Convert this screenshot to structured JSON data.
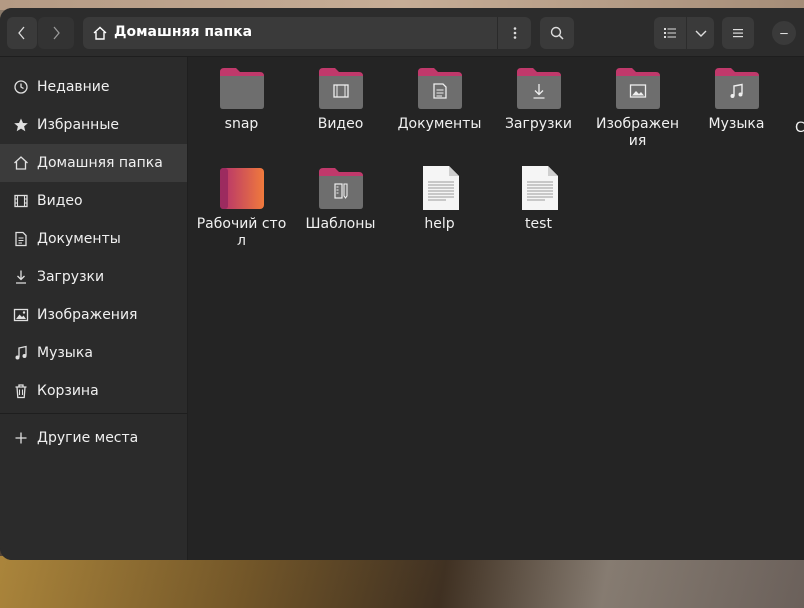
{
  "window": {
    "title": "Домашняя папка"
  },
  "pathbar": {
    "location": "Домашняя папка"
  },
  "sidebar": {
    "items": [
      {
        "label": "Недавние",
        "icon": "clock-icon"
      },
      {
        "label": "Избранные",
        "icon": "star-icon"
      },
      {
        "label": "Домашняя папка",
        "icon": "home-icon",
        "active": true
      },
      {
        "label": "Видео",
        "icon": "video-icon"
      },
      {
        "label": "Документы",
        "icon": "document-icon"
      },
      {
        "label": "Загрузки",
        "icon": "download-icon"
      },
      {
        "label": "Изображения",
        "icon": "image-icon"
      },
      {
        "label": "Музыка",
        "icon": "music-icon"
      },
      {
        "label": "Корзина",
        "icon": "trash-icon"
      }
    ],
    "other_places": {
      "label": "Другие места",
      "icon": "plus-icon"
    }
  },
  "files": [
    {
      "name": "snap",
      "type": "folder",
      "emblem": ""
    },
    {
      "name": "Видео",
      "type": "folder",
      "emblem": "video"
    },
    {
      "name": "Документы",
      "type": "folder",
      "emblem": "document"
    },
    {
      "name": "Загрузки",
      "type": "folder",
      "emblem": "download"
    },
    {
      "name": "Изображения",
      "type": "folder",
      "emblem": "image"
    },
    {
      "name": "Музыка",
      "type": "folder",
      "emblem": "music"
    },
    {
      "name": "Рабочий стол",
      "type": "desktop-folder",
      "emblem": ""
    },
    {
      "name": "Шаблоны",
      "type": "folder",
      "emblem": "template"
    },
    {
      "name": "help",
      "type": "text-file",
      "emblem": ""
    },
    {
      "name": "test",
      "type": "text-file",
      "emblem": ""
    }
  ],
  "overflow_peek": "С",
  "colors": {
    "accent": "#e95420",
    "folder_tab": "#c0396b",
    "folder_body": "#6e6e6e"
  }
}
